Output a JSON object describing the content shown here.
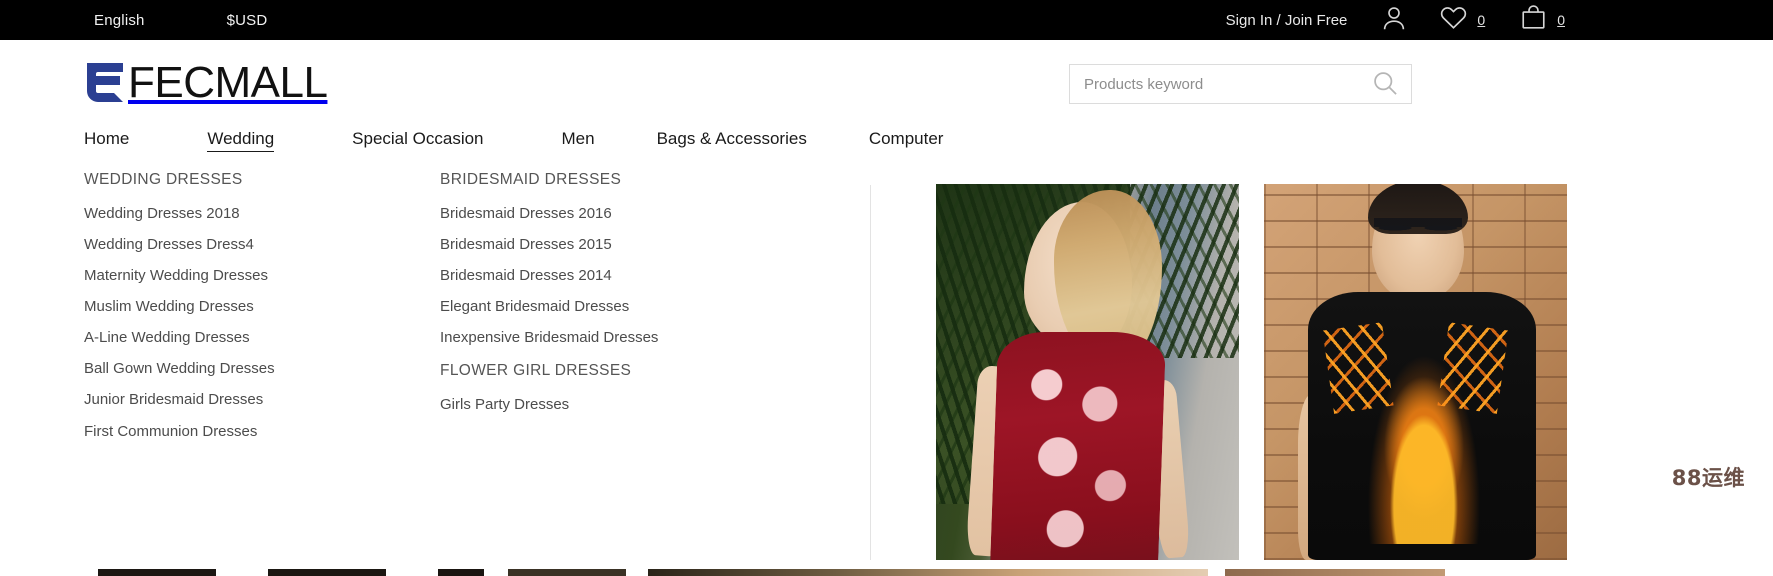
{
  "topbar": {
    "language": "English",
    "currency": "$USD",
    "signin": "Sign In / Join Free",
    "icons": {
      "account": "user-icon",
      "wishlist": "heart-icon",
      "cart": "shopping-bag-icon"
    },
    "wishlist_count": "0",
    "cart_count": "0",
    "background_color": "#000000"
  },
  "header": {
    "logo_text": "FECMALL",
    "logo_mark_color": "#2b3f92",
    "logo_text_color": "#111111"
  },
  "search": {
    "placeholder": "Products keyword",
    "value": "",
    "icon": "search-icon"
  },
  "nav": {
    "items": [
      {
        "label": "Home",
        "active": false
      },
      {
        "label": "Wedding",
        "active": true
      },
      {
        "label": "Special Occasion",
        "active": false
      },
      {
        "label": "Men",
        "active": false
      },
      {
        "label": "Bags & Accessories",
        "active": false
      },
      {
        "label": "Computer",
        "active": false
      }
    ]
  },
  "mega_menu": {
    "column_1": {
      "heading": "WEDDING DRESSES",
      "links": [
        "Wedding Dresses 2018",
        "Wedding Dresses Dress4",
        "Maternity Wedding Dresses",
        "Muslim Wedding Dresses",
        "A-Line Wedding Dresses",
        "Ball Gown Wedding Dresses",
        "Junior Bridesmaid Dresses"
      ],
      "extra_link": "First Communion Dresses"
    },
    "column_2": {
      "heading": "BRIDESMAID DRESSES",
      "links": [
        "Bridesmaid Dresses 2016",
        "Bridesmaid Dresses 2015",
        "Bridesmaid Dresses 2014",
        "Elegant Bridesmaid Dresses",
        "Inexpensive Bridesmaid Dresses"
      ],
      "heading_2": "FLOWER GIRL DRESSES",
      "links_2": [
        "Girls Party Dresses"
      ]
    }
  },
  "promo": {
    "items": [
      {
        "alt": "woman-in-red-floral-dress"
      },
      {
        "alt": "man-in-black-stag-print-tshirt"
      }
    ]
  },
  "watermark": {
    "text": "88运维",
    "color": "#6b5148"
  }
}
